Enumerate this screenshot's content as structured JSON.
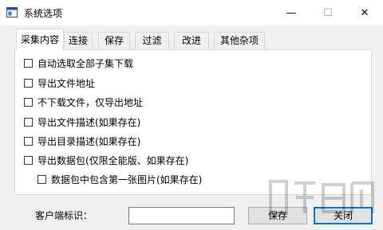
{
  "window": {
    "title": "系统选项",
    "min_glyph": "—",
    "max_glyph": "☐",
    "close_glyph": "✕"
  },
  "tabs": [
    {
      "label": "采集内容",
      "active": true
    },
    {
      "label": "连接",
      "active": false
    },
    {
      "label": "保存",
      "active": false
    },
    {
      "label": "过滤",
      "active": false
    },
    {
      "label": "改进",
      "active": false
    },
    {
      "label": "其他杂项",
      "active": false
    }
  ],
  "options": [
    {
      "label": "自动选取全部子集下载",
      "checked": false
    },
    {
      "label": "导出文件地址",
      "checked": false
    },
    {
      "label": "不下载文件，仅导出地址",
      "checked": false
    },
    {
      "label": "导出文件描述(如果存在)",
      "checked": false
    },
    {
      "label": "导出目录描述(如果存在)",
      "checked": false
    },
    {
      "label": "导出数据包(仅限全能版、如果存在)",
      "checked": false
    },
    {
      "label": "数据包中包含第一张图片(如果存在)",
      "checked": false
    }
  ],
  "footer": {
    "client_label": "客户端标识：",
    "client_value": "",
    "save_label": "保存",
    "close_label": "关闭"
  },
  "colors": {
    "focus_border": "#0078d7",
    "panel_bg": "#ffffff",
    "window_bg": "#f0f0f0"
  }
}
